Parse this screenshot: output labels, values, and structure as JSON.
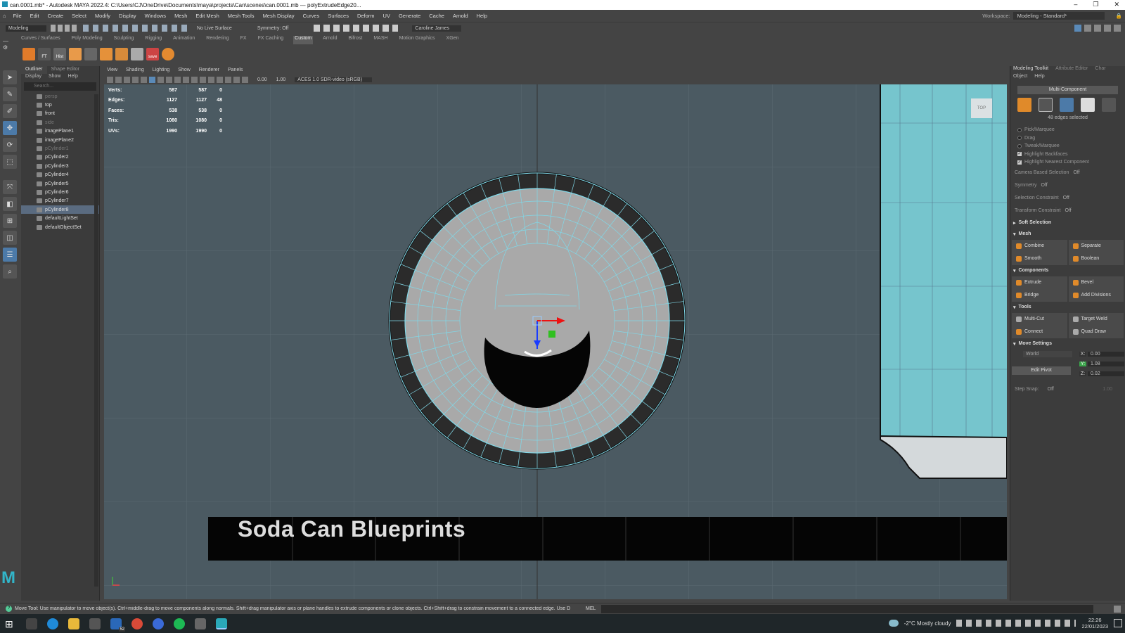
{
  "window": {
    "title": "can.0001.mb* - Autodesk MAYA 2022.4: C:\\Users\\CJ\\OneDrive\\Documents\\maya\\projects\\Can\\scenes\\can.0001.mb   ---   polyExtrudeEdge20..."
  },
  "menubar": [
    "File",
    "Edit",
    "Create",
    "Select",
    "Modify",
    "Display",
    "Windows",
    "Mesh",
    "Edit Mesh",
    "Mesh Tools",
    "Mesh Display",
    "Curves",
    "Surfaces",
    "Deform",
    "UV",
    "Generate",
    "Cache",
    "Arnold",
    "Help"
  ],
  "workspace": {
    "label": "Workspace:",
    "value": "Modeling - Standard*"
  },
  "status_line": {
    "mode": "Modeling",
    "live_surface": "No Live Surface",
    "symmetry": "Symmetry: Off",
    "user": "Caroline James"
  },
  "shelf_tabs": [
    "Curves / Surfaces",
    "Poly Modeling",
    "Sculpting",
    "Rigging",
    "Animation",
    "Rendering",
    "FX",
    "FX Caching",
    "Custom",
    "Arnold",
    "Bifrost",
    "MASH",
    "Motion Graphics",
    "XGen"
  ],
  "shelf_active": "Custom",
  "shelf_labels": {
    "ft": "FT",
    "hist": "Hist",
    "save": "save"
  },
  "outliner": {
    "tabs": [
      "Outliner",
      "Shape Editor"
    ],
    "menu": [
      "Display",
      "Show",
      "Help"
    ],
    "search_placeholder": "Search...",
    "items": [
      {
        "name": "persp",
        "dim": true
      },
      {
        "name": "top",
        "dim": false
      },
      {
        "name": "front",
        "dim": false
      },
      {
        "name": "side",
        "dim": true
      },
      {
        "name": "imagePlane1",
        "dim": false
      },
      {
        "name": "imagePlane2",
        "dim": false
      },
      {
        "name": "pCylinder1",
        "dim": true
      },
      {
        "name": "pCylinder2",
        "dim": false
      },
      {
        "name": "pCylinder3",
        "dim": false
      },
      {
        "name": "pCylinder4",
        "dim": false
      },
      {
        "name": "pCylinder5",
        "dim": false
      },
      {
        "name": "pCylinder6",
        "dim": false
      },
      {
        "name": "pCylinder7",
        "dim": false
      },
      {
        "name": "pCylinder8",
        "dim": false,
        "selected": true
      },
      {
        "name": "defaultLightSet",
        "dim": false
      },
      {
        "name": "defaultObjectSet",
        "dim": false
      }
    ]
  },
  "viewport": {
    "menu": [
      "View",
      "Shading",
      "Lighting",
      "Show",
      "Renderer",
      "Panels"
    ],
    "exposure": "0.00",
    "gamma": "1.00",
    "colorspace": "ACES 1.0 SDR-video (sRGB)",
    "camera_label": "TOP",
    "hud": [
      {
        "label": "Verts:",
        "a": "587",
        "b": "587",
        "c": "0"
      },
      {
        "label": "Edges:",
        "a": "1127",
        "b": "1127",
        "c": "48"
      },
      {
        "label": "Faces:",
        "a": "538",
        "b": "538",
        "c": "0"
      },
      {
        "label": "Tris:",
        "a": "1080",
        "b": "1080",
        "c": "0"
      },
      {
        "label": "UVs:",
        "a": "1990",
        "b": "1990",
        "c": "0"
      }
    ],
    "banner": "Soda Can Blueprints"
  },
  "modeling_toolkit": {
    "tabs": [
      "Modeling Toolkit",
      "Attribute Editor",
      "Char"
    ],
    "menu": [
      "Object",
      "Help"
    ],
    "multi_component": "Multi-Component",
    "edges_selected": "48 edges selected",
    "pick_modes": [
      "Pick/Marquee",
      "Drag",
      "Tweak/Marquee"
    ],
    "checks": [
      "Highlight Backfaces",
      "Highlight Nearest Component"
    ],
    "props": [
      {
        "label": "Camera Based Selection",
        "value": "Off"
      },
      {
        "label": "Symmetry",
        "value": "Off"
      },
      {
        "label": "Selection Constraint",
        "value": "Off"
      },
      {
        "label": "Transform Constraint",
        "value": "Off"
      }
    ],
    "soft_selection": "Soft Selection",
    "mesh_header": "Mesh",
    "mesh_buttons": [
      [
        "Combine",
        "Separate"
      ],
      [
        "Smooth",
        "Boolean"
      ]
    ],
    "components_header": "Components",
    "components_buttons": [
      [
        "Extrude",
        "Bevel"
      ],
      [
        "Bridge",
        "Add Divisions"
      ]
    ],
    "tools_header": "Tools",
    "tools_buttons": [
      [
        "Multi-Cut",
        "Target Weld"
      ],
      [
        "Connect",
        "Quad Draw"
      ]
    ],
    "move_settings": "Move Settings",
    "world": "World",
    "edit_pivot": "Edit Pivot",
    "x": "0.00",
    "y": "1.08",
    "z": "0.02",
    "step_snap_label": "Step Snap:",
    "step_snap_value": "Off",
    "step_snap_num": "1.00"
  },
  "help_line": "Move Tool: Use manipulator to move object(s). Ctrl+middle-drag to move components along normals. Shift+drag manipulator axis or plane handles to extrude components or clone objects. Ctrl+Shift+drag to constrain movement to a connected edge. Use D or INSERT to change t",
  "command_line_label": "MEL",
  "taskbar": {
    "mail_badge": "52",
    "weather": "-2°C  Mostly cloudy",
    "time": "22:26",
    "date": "22/01/2023"
  }
}
